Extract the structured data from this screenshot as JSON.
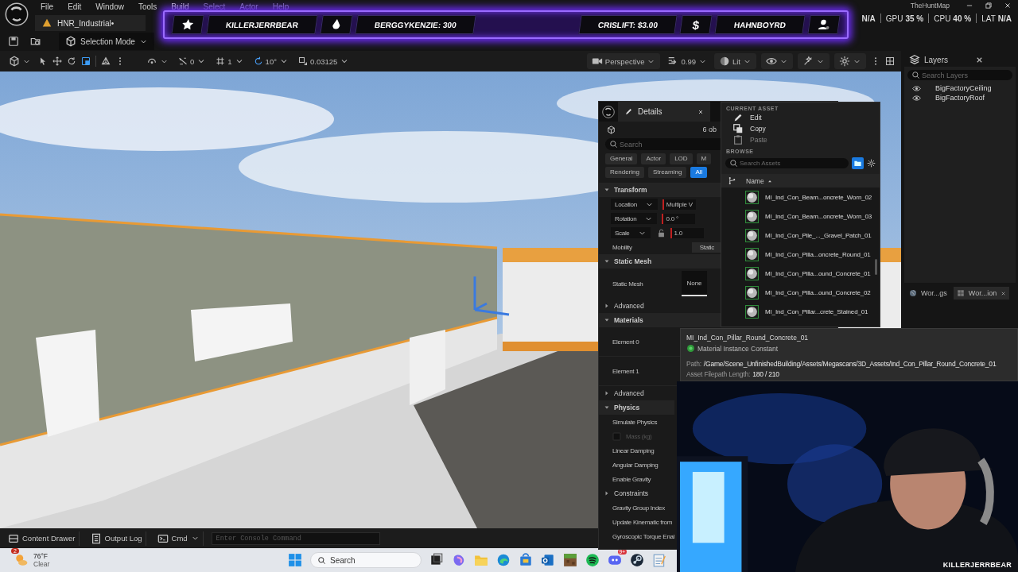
{
  "menu_bar": {
    "items": [
      "File",
      "Edit",
      "Window",
      "Tools",
      "Build",
      "Select",
      "Actor",
      "Help"
    ],
    "level_tab": "HNR_Industrial•",
    "project": "TheHuntMap"
  },
  "stats": [
    {
      "value": "N/A"
    },
    {
      "label": "GPU",
      "value": "35 %"
    },
    {
      "label": "CPU",
      "value": "40 %"
    },
    {
      "label": "LAT",
      "value": "N/A"
    }
  ],
  "main_toolbar": {
    "mode": "Selection Mode"
  },
  "stream_banner": [
    {
      "kind": "star"
    },
    {
      "kind": "name",
      "text": "KILLERJERRBEAR"
    },
    {
      "kind": "drop"
    },
    {
      "kind": "name",
      "text": "BERGGYKENZIE: 300"
    },
    {
      "kind": "gap"
    },
    {
      "kind": "name",
      "text": "CRISLIFT: $3.00"
    },
    {
      "kind": "glyph",
      "text": "$"
    },
    {
      "kind": "name",
      "text": "HAHNBOYRD"
    },
    {
      "kind": "person"
    }
  ],
  "viewport_toolbar": {
    "tools": [
      {
        "kind": "select",
        "selected": false
      },
      {
        "kind": "translate",
        "selected": false
      },
      {
        "kind": "rotate",
        "selected": false
      },
      {
        "kind": "scale",
        "selected": true
      }
    ],
    "snaps": [
      {
        "kind": "surface",
        "value": "0",
        "on": false
      },
      {
        "kind": "grid",
        "value": "1",
        "on": false
      },
      {
        "kind": "rotation",
        "value": "10°",
        "on": true
      },
      {
        "kind": "scale",
        "value": "0.03125",
        "on": false
      }
    ],
    "view": "Perspective",
    "camera_speed": "0.99",
    "lighting": "Lit"
  },
  "details": {
    "title": "Details",
    "selection": "6 ob",
    "search_placeholder": "Search",
    "filters": [
      [
        {
          "label": "General",
          "selected": false
        },
        {
          "label": "Actor",
          "selected": false
        },
        {
          "label": "LOD",
          "selected": false
        },
        {
          "label": "M",
          "selected": false
        }
      ],
      [
        {
          "label": "Rendering",
          "selected": false
        },
        {
          "label": "Streaming",
          "selected": false
        },
        {
          "label": "All",
          "selected": true
        }
      ]
    ],
    "rows": [
      {
        "kind": "section",
        "label": "Transform",
        "expanded": true
      },
      {
        "kind": "transform",
        "label": "Location",
        "value": "Multiple V"
      },
      {
        "kind": "transform",
        "label": "Rotation",
        "value": "0.0 °"
      },
      {
        "kind": "transform",
        "label": "Scale",
        "value": "1.0",
        "lock_icon": true
      },
      {
        "kind": "property",
        "label": "Mobility",
        "value": "Static"
      },
      {
        "kind": "section",
        "label": "Static Mesh",
        "expanded": true
      },
      {
        "kind": "mesh",
        "label": "Static Mesh",
        "value": "None"
      },
      {
        "kind": "subsection",
        "label": "Advanced",
        "expanded": false
      },
      {
        "kind": "section",
        "label": "Materials",
        "expanded": true
      },
      {
        "kind": "element",
        "label": "Element 0"
      },
      {
        "kind": "element",
        "label": "Element 1"
      },
      {
        "kind": "subsection",
        "label": "Advanced",
        "expanded": false
      },
      {
        "kind": "section",
        "label": "Physics",
        "expanded": true
      },
      {
        "kind": "property",
        "label": "Simulate Physics"
      },
      {
        "kind": "checkbox",
        "label": "Mass (kg)",
        "checked": false,
        "disabled": true
      },
      {
        "kind": "property",
        "label": "Linear Damping"
      },
      {
        "kind": "property",
        "label": "Angular Damping"
      },
      {
        "kind": "property",
        "label": "Enable Gravity"
      },
      {
        "kind": "subsection",
        "label": "Constraints",
        "expanded": false
      },
      {
        "kind": "property",
        "label": "Gravity Group Index"
      },
      {
        "kind": "property",
        "label": "Update Kinematic from"
      },
      {
        "kind": "property",
        "label": "Gyroscopic Torque Enal"
      }
    ]
  },
  "asset_picker": {
    "current_heading": "CURRENT ASSET",
    "actions": [
      {
        "kind": "edit",
        "label": "Edit",
        "disabled": false
      },
      {
        "kind": "copy",
        "label": "Copy",
        "disabled": false
      },
      {
        "kind": "paste",
        "label": "Paste",
        "disabled": true
      }
    ],
    "browse_heading": "BROWSE",
    "search_placeholder": "Search Assets",
    "column": "Name",
    "assets": [
      "MI_Ind_Con_Beam...oncrete_Worn_02",
      "MI_Ind_Con_Beam...oncrete_Worn_03",
      "MI_Ind_Con_Pile_..._Gravel_Patch_01",
      "MI_Ind_Con_Pilla...oncrete_Round_01",
      "MI_Ind_Con_Pilla...ound_Concrete_01",
      "MI_Ind_Con_Pilla...ound_Concrete_02",
      "MI_Ind_Con_Pillar...crete_Stained_01"
    ]
  },
  "tooltip": {
    "title": "MI_Ind_Con_Pillar_Round_Concrete_01",
    "type": "Material Instance Constant",
    "path_label": "Path:",
    "path": "/Game/Scene_UnfinishedBuilding/Assets/Megascans/3D_Assets/Ind_Con_Pillar_Round_Concrete_01",
    "length_label": "Asset Filepath Length:",
    "length": "180 / 210"
  },
  "layers": {
    "title": "Layers",
    "search_placeholder": "Search Layers",
    "items": [
      {
        "name": "BigFactoryCeiling",
        "visible": true
      },
      {
        "name": "BigFactoryRoof",
        "visible": true
      }
    ],
    "tabs": [
      {
        "kind": "globe",
        "label": "Wor...gs",
        "closable": false,
        "selected": false
      },
      {
        "kind": "grid",
        "label": "Wor...ion",
        "closable": true,
        "selected": true
      }
    ]
  },
  "bottom_bar": {
    "buttons": [
      {
        "kind": "drawer",
        "label": "Content Drawer"
      },
      {
        "kind": "log",
        "label": "Output Log"
      },
      {
        "kind": "cmd",
        "label": "Cmd"
      }
    ],
    "console_placeholder": "Enter Console Command"
  },
  "webcam": {
    "kind": "picture",
    "caption": "KILLERJERRBEAR"
  },
  "taskbar": {
    "weather": {
      "badge": "2",
      "temperature": "76°F",
      "condition": "Clear"
    },
    "search_placeholder": "Search",
    "apps": [
      {
        "kind": "taskview"
      },
      {
        "kind": "copilot"
      },
      {
        "kind": "files"
      },
      {
        "kind": "edge"
      },
      {
        "kind": "store"
      },
      {
        "kind": "outlook"
      },
      {
        "kind": "minecraft"
      },
      {
        "kind": "spotify"
      },
      {
        "kind": "discord",
        "badge": "9+"
      },
      {
        "kind": "steam"
      },
      {
        "kind": "notepad"
      }
    ]
  }
}
